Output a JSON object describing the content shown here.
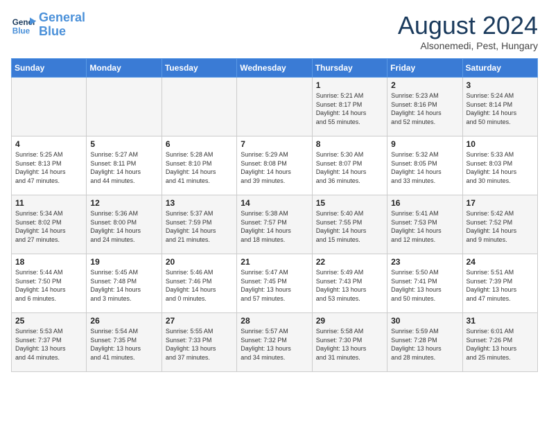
{
  "header": {
    "logo_line1": "General",
    "logo_line2": "Blue",
    "month": "August 2024",
    "location": "Alsonemedi, Pest, Hungary"
  },
  "weekdays": [
    "Sunday",
    "Monday",
    "Tuesday",
    "Wednesday",
    "Thursday",
    "Friday",
    "Saturday"
  ],
  "weeks": [
    [
      {
        "day": "",
        "info": ""
      },
      {
        "day": "",
        "info": ""
      },
      {
        "day": "",
        "info": ""
      },
      {
        "day": "",
        "info": ""
      },
      {
        "day": "1",
        "info": "Sunrise: 5:21 AM\nSunset: 8:17 PM\nDaylight: 14 hours\nand 55 minutes."
      },
      {
        "day": "2",
        "info": "Sunrise: 5:23 AM\nSunset: 8:16 PM\nDaylight: 14 hours\nand 52 minutes."
      },
      {
        "day": "3",
        "info": "Sunrise: 5:24 AM\nSunset: 8:14 PM\nDaylight: 14 hours\nand 50 minutes."
      }
    ],
    [
      {
        "day": "4",
        "info": "Sunrise: 5:25 AM\nSunset: 8:13 PM\nDaylight: 14 hours\nand 47 minutes."
      },
      {
        "day": "5",
        "info": "Sunrise: 5:27 AM\nSunset: 8:11 PM\nDaylight: 14 hours\nand 44 minutes."
      },
      {
        "day": "6",
        "info": "Sunrise: 5:28 AM\nSunset: 8:10 PM\nDaylight: 14 hours\nand 41 minutes."
      },
      {
        "day": "7",
        "info": "Sunrise: 5:29 AM\nSunset: 8:08 PM\nDaylight: 14 hours\nand 39 minutes."
      },
      {
        "day": "8",
        "info": "Sunrise: 5:30 AM\nSunset: 8:07 PM\nDaylight: 14 hours\nand 36 minutes."
      },
      {
        "day": "9",
        "info": "Sunrise: 5:32 AM\nSunset: 8:05 PM\nDaylight: 14 hours\nand 33 minutes."
      },
      {
        "day": "10",
        "info": "Sunrise: 5:33 AM\nSunset: 8:03 PM\nDaylight: 14 hours\nand 30 minutes."
      }
    ],
    [
      {
        "day": "11",
        "info": "Sunrise: 5:34 AM\nSunset: 8:02 PM\nDaylight: 14 hours\nand 27 minutes."
      },
      {
        "day": "12",
        "info": "Sunrise: 5:36 AM\nSunset: 8:00 PM\nDaylight: 14 hours\nand 24 minutes."
      },
      {
        "day": "13",
        "info": "Sunrise: 5:37 AM\nSunset: 7:59 PM\nDaylight: 14 hours\nand 21 minutes."
      },
      {
        "day": "14",
        "info": "Sunrise: 5:38 AM\nSunset: 7:57 PM\nDaylight: 14 hours\nand 18 minutes."
      },
      {
        "day": "15",
        "info": "Sunrise: 5:40 AM\nSunset: 7:55 PM\nDaylight: 14 hours\nand 15 minutes."
      },
      {
        "day": "16",
        "info": "Sunrise: 5:41 AM\nSunset: 7:53 PM\nDaylight: 14 hours\nand 12 minutes."
      },
      {
        "day": "17",
        "info": "Sunrise: 5:42 AM\nSunset: 7:52 PM\nDaylight: 14 hours\nand 9 minutes."
      }
    ],
    [
      {
        "day": "18",
        "info": "Sunrise: 5:44 AM\nSunset: 7:50 PM\nDaylight: 14 hours\nand 6 minutes."
      },
      {
        "day": "19",
        "info": "Sunrise: 5:45 AM\nSunset: 7:48 PM\nDaylight: 14 hours\nand 3 minutes."
      },
      {
        "day": "20",
        "info": "Sunrise: 5:46 AM\nSunset: 7:46 PM\nDaylight: 14 hours\nand 0 minutes."
      },
      {
        "day": "21",
        "info": "Sunrise: 5:47 AM\nSunset: 7:45 PM\nDaylight: 13 hours\nand 57 minutes."
      },
      {
        "day": "22",
        "info": "Sunrise: 5:49 AM\nSunset: 7:43 PM\nDaylight: 13 hours\nand 53 minutes."
      },
      {
        "day": "23",
        "info": "Sunrise: 5:50 AM\nSunset: 7:41 PM\nDaylight: 13 hours\nand 50 minutes."
      },
      {
        "day": "24",
        "info": "Sunrise: 5:51 AM\nSunset: 7:39 PM\nDaylight: 13 hours\nand 47 minutes."
      }
    ],
    [
      {
        "day": "25",
        "info": "Sunrise: 5:53 AM\nSunset: 7:37 PM\nDaylight: 13 hours\nand 44 minutes."
      },
      {
        "day": "26",
        "info": "Sunrise: 5:54 AM\nSunset: 7:35 PM\nDaylight: 13 hours\nand 41 minutes."
      },
      {
        "day": "27",
        "info": "Sunrise: 5:55 AM\nSunset: 7:33 PM\nDaylight: 13 hours\nand 37 minutes."
      },
      {
        "day": "28",
        "info": "Sunrise: 5:57 AM\nSunset: 7:32 PM\nDaylight: 13 hours\nand 34 minutes."
      },
      {
        "day": "29",
        "info": "Sunrise: 5:58 AM\nSunset: 7:30 PM\nDaylight: 13 hours\nand 31 minutes."
      },
      {
        "day": "30",
        "info": "Sunrise: 5:59 AM\nSunset: 7:28 PM\nDaylight: 13 hours\nand 28 minutes."
      },
      {
        "day": "31",
        "info": "Sunrise: 6:01 AM\nSunset: 7:26 PM\nDaylight: 13 hours\nand 25 minutes."
      }
    ]
  ]
}
